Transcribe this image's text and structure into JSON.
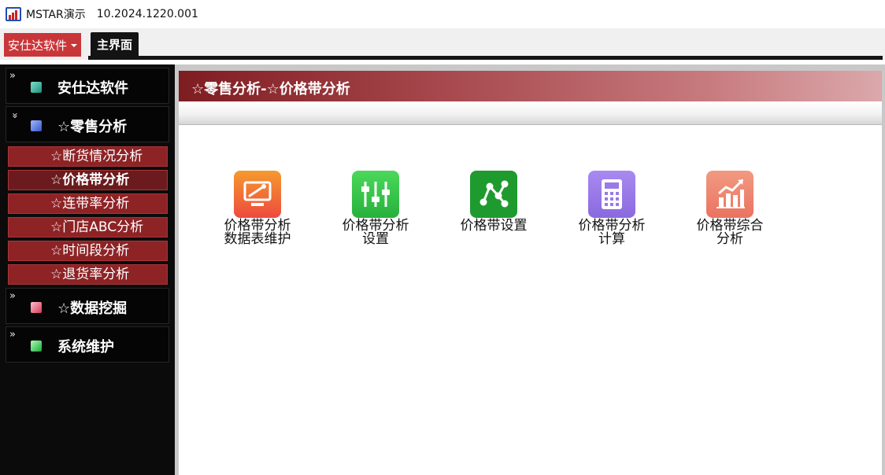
{
  "window": {
    "title": "MSTAR演示",
    "version": "10.2024.1220.001"
  },
  "tabs": {
    "brand_label": "安仕达软件",
    "main_tab": "主界面"
  },
  "sidebar": {
    "categories": [
      {
        "label": "安仕达软件",
        "icon": "teal-square-icon",
        "color": "#2fa38f"
      },
      {
        "label": "☆零售分析",
        "icon": "blue-square-icon",
        "color": "#4a6fd6"
      },
      {
        "label": "☆数据挖掘",
        "icon": "pink-square-icon",
        "color": "#e0546e"
      },
      {
        "label": "系统维护",
        "icon": "green-square-icon",
        "color": "#2bb84a"
      }
    ],
    "retail_items": [
      {
        "label": "☆断货情况分析",
        "active": false
      },
      {
        "label": "☆价格带分析",
        "active": true
      },
      {
        "label": "☆连带率分析",
        "active": false
      },
      {
        "label": "☆门店ABC分析",
        "active": false
      },
      {
        "label": "☆时间段分析",
        "active": false
      },
      {
        "label": "☆退货率分析",
        "active": false
      }
    ]
  },
  "panel": {
    "title": "☆零售分析-☆价格带分析",
    "tiles": [
      {
        "line1": "价格带分析",
        "line2": "数据表维护",
        "icon": "monitor-wrench-icon",
        "color": "#f0702a"
      },
      {
        "line1": "价格带分析",
        "line2": "设置",
        "icon": "sliders-icon",
        "color": "#35c247"
      },
      {
        "line1": "价格带设置",
        "line2": "",
        "icon": "network-nodes-icon",
        "color": "#1f9a2f"
      },
      {
        "line1": "价格带分析",
        "line2": "计算",
        "icon": "calculator-icon",
        "color": "#9b7ae8"
      },
      {
        "line1": "价格带综合",
        "line2": "分析",
        "icon": "bar-chart-icon",
        "color": "#ef8a72"
      }
    ]
  },
  "colors": {
    "accent_red": "#c9363a",
    "sidebar_item": "#8e2326",
    "header_dark": "#141414"
  }
}
